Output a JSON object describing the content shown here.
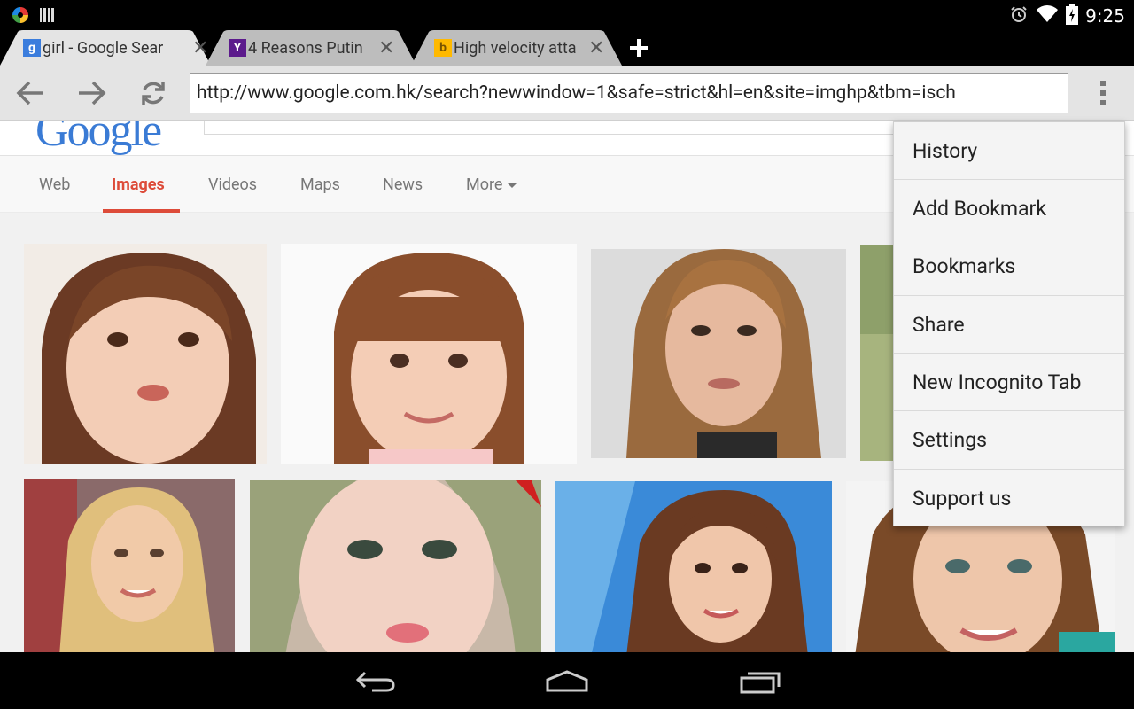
{
  "status_bar": {
    "time": "9:25",
    "left_icons": [
      "app-notification-icon",
      "barcode-notification-icon"
    ],
    "right_icons": [
      "alarm-icon",
      "wifi-icon",
      "battery-charging-icon"
    ]
  },
  "tabs": [
    {
      "favicon": "g",
      "favicon_color": "#3b7ddd",
      "title": "girl - Google Sear",
      "active": true
    },
    {
      "favicon": "Y",
      "favicon_color": "#5c1a8c",
      "title": "4 Reasons Putin",
      "active": false
    },
    {
      "favicon": "b",
      "favicon_color": "#ffb900",
      "title": "High velocity atta",
      "active": false
    }
  ],
  "toolbar": {
    "url": "http://www.google.com.hk/search?newwindow=1&safe=strict&hl=en&site=imghp&tbm=isch"
  },
  "google": {
    "logo_fragment": "Google",
    "nav_tabs": [
      {
        "label": "Web",
        "active": false
      },
      {
        "label": "Images",
        "active": true
      },
      {
        "label": "Videos",
        "active": false
      },
      {
        "label": "Maps",
        "active": false
      },
      {
        "label": "News",
        "active": false
      },
      {
        "label": "More",
        "active": false
      }
    ]
  },
  "menu": {
    "items": [
      "History",
      "Add Bookmark",
      "Bookmarks",
      "Share",
      "New Incognito Tab",
      "Settings",
      "Support us"
    ]
  },
  "colors": {
    "accent_red": "#dd4b39",
    "toolbar_bg": "#e4e4e4",
    "page_bg": "#f1f1f1"
  }
}
